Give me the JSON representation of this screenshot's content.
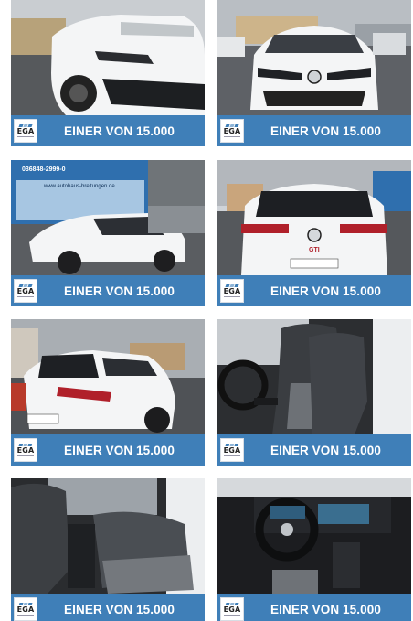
{
  "gallery": {
    "brand_logo_text": "EGA",
    "banner_text": "EINER VON 15.000",
    "tiles": [
      {
        "scene": "front-quarter-left",
        "banner": "EINER VON 15.000",
        "logo": "EGA"
      },
      {
        "scene": "front",
        "banner": "EINER VON 15.000",
        "logo": "EGA"
      },
      {
        "scene": "front-quarter-showroom",
        "banner": "EINER VON 15.000",
        "logo": "EGA",
        "sign_text": "036848-2999-0",
        "url_text": "www.autohaus-breitungen.de"
      },
      {
        "scene": "rear",
        "banner": "EINER VON 15.000",
        "logo": "EGA",
        "badge_text": "GTI"
      },
      {
        "scene": "rear-quarter",
        "banner": "EINER VON 15.000",
        "logo": "EGA"
      },
      {
        "scene": "front-seats",
        "banner": "EINER VON 15.000",
        "logo": "EGA"
      },
      {
        "scene": "rear-seats",
        "banner": "EINER VON 15.000",
        "logo": "EGA"
      },
      {
        "scene": "cockpit",
        "banner": "EINER VON 15.000",
        "logo": "EGA"
      }
    ]
  },
  "colors": {
    "banner_blue": "#3f7fb8",
    "car_white": "#f4f5f6",
    "tail_red": "#b0202a",
    "sky": "#8d949b"
  }
}
